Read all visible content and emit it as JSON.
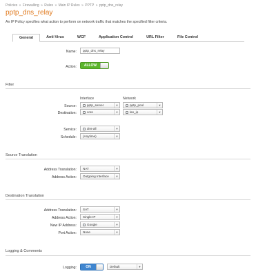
{
  "breadcrumb": [
    "Policies",
    "»",
    "Firewalling",
    "»",
    "Rules",
    "»",
    "Main IP Rules",
    "»",
    "PPTP",
    "»",
    "pptp_dns_relay"
  ],
  "title": "pptp_dns_relay",
  "description": "An IP Policy specifies what action to perform on network traffic that matches the specified filter criteria.",
  "tabs": [
    "General",
    "Anti-Virus",
    "WCF",
    "Application Control",
    "URL Filter",
    "File Control"
  ],
  "general": {
    "name_label": "Name:",
    "name_value": "pptp_dns_relay",
    "action_label": "Action:",
    "action_value": "ALLOW"
  },
  "filter": {
    "section": "Filter",
    "interface_head": "Interface",
    "network_head": "Network",
    "source_label": "Source:",
    "source_interface": "pptp_server",
    "source_network": "pptp_pool",
    "destination_label": "Destination:",
    "destination_interface": "core",
    "destination_network": "lan_ip",
    "service_label": "Service:",
    "service_value": "dns-all",
    "schedule_label": "Schedule:",
    "schedule_value": "(Anytime)"
  },
  "source_translation": {
    "section": "Source Translation",
    "address_translation_label": "Address Translation:",
    "address_translation_value": "NAT",
    "address_action_label": "Address Action:",
    "address_action_value": "Outgoing Interface"
  },
  "destination_translation": {
    "section": "Destination Translation",
    "address_translation_label": "Address Translation:",
    "address_translation_value": "SAT",
    "address_action_label": "Address Action:",
    "address_action_value": "Single IP",
    "new_ip_label": "New IP Address:",
    "new_ip_value": "Google",
    "port_action_label": "Port Action:",
    "port_action_value": "None"
  },
  "logging": {
    "section": "Logging & Comments",
    "logging_label": "Logging:",
    "logging_value": "ON",
    "log_level_value": "Default"
  },
  "colors": {
    "title": "#e07a1f",
    "toggle_allow": "#5bb52b",
    "toggle_on": "#3f86d0"
  }
}
